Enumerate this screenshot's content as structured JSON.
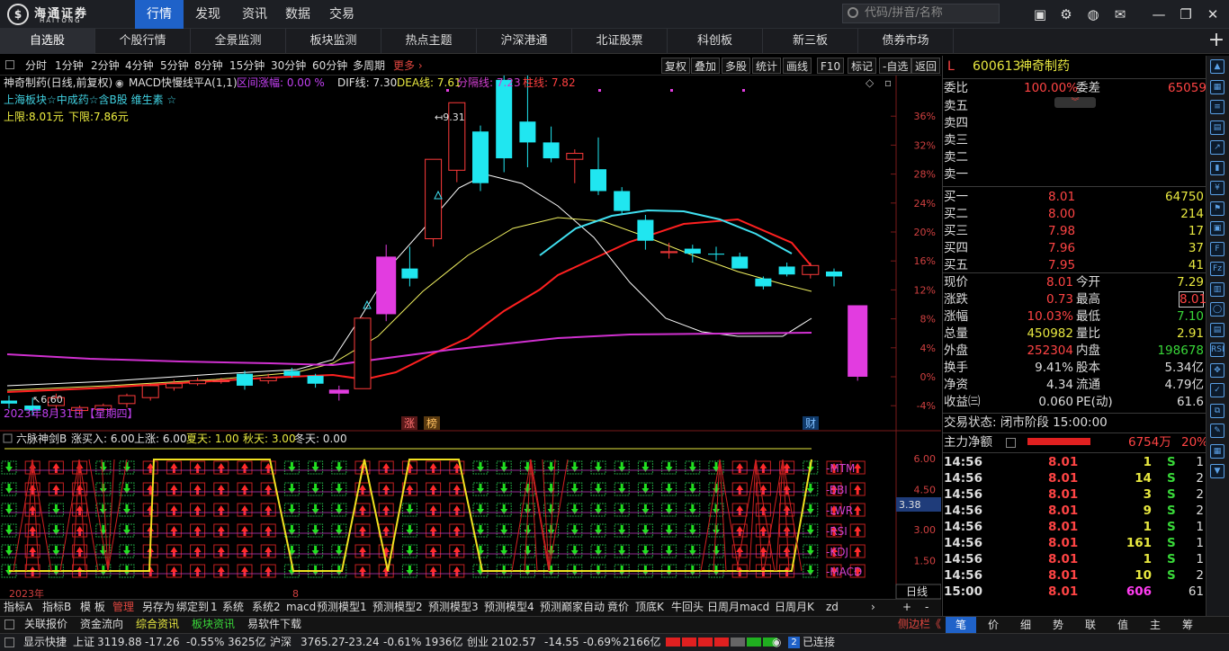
{
  "app": {
    "logo_text": "海通证券",
    "logo_sub": "HAITONG",
    "menu": [
      "行情",
      "发现",
      "资讯",
      "数据",
      "交易"
    ],
    "search_placeholder": "代码/拼音/名称"
  },
  "tabs": [
    "自选股",
    "个股行情",
    "全景监测",
    "板块监测",
    "热点主题",
    "沪深港通",
    "北证股票",
    "科创板",
    "新三板",
    "债券市场"
  ],
  "periods": [
    "分时",
    "1分钟",
    "2分钟",
    "4分钟",
    "5分钟",
    "8分钟",
    "15分钟",
    "30分钟",
    "60分钟",
    "多周期"
  ],
  "more": "更多",
  "tools": [
    "复权",
    "叠加",
    "多股",
    "统计",
    "画线",
    "F10",
    "标记",
    "-自选",
    "返回"
  ],
  "kline": {
    "title": "神奇制药(日线,前复权)",
    "indicator_name": "MACD快慢线平A(1,1)",
    "range_label": "区间涨幅: 0.00 %",
    "dif": "DIF线: 7.30",
    "dea": "DEA线: 7.61",
    "sep": "分隔线: 7.23",
    "zhu": "柱线: 7.82",
    "board": "上海板块☆中成药☆含B股 维生素 ☆",
    "upper": "上限:8.01元",
    "lower": "下限:7.86元",
    "high_label": "9.31",
    "low_label": "6.60",
    "date": "2023年8月31日【星期四】",
    "mark1": "涨",
    "mark2": "榜",
    "mark3": "财",
    "yticks": [
      "36%",
      "32%",
      "28%",
      "24%",
      "20%",
      "16%",
      "12%",
      "8%",
      "4%",
      "0%",
      "-4%"
    ]
  },
  "sub": {
    "title": "六脉神剑B",
    "buy": "涨买入: 6.00",
    "up": "上涨: 6.00",
    "summer": "夏天: 1.00",
    "autumn": "秋天: 3.00",
    "winter": "冬天: 0.00",
    "rows": [
      "MTM",
      "BBI",
      "LWR",
      "RSI",
      "KDJ",
      "MACD"
    ],
    "yticks": [
      "6.00",
      "4.50",
      "3.00",
      "1.50"
    ],
    "cursor_val": "3.38",
    "xlab1": "2023年",
    "xlab2": "8",
    "xlab3": "日线"
  },
  "chart_data": {
    "type": "candlestick",
    "candles": [
      [
        7.05,
        7.02,
        7.1,
        6.97
      ],
      [
        7.0,
        6.95,
        7.08,
        6.9
      ],
      [
        7.0,
        7.08,
        7.12,
        6.95
      ],
      [
        6.95,
        6.98,
        7.0,
        6.9
      ],
      [
        6.96,
        7.0,
        7.02,
        6.93
      ],
      [
        7.02,
        7.1,
        7.12,
        6.98
      ],
      [
        7.08,
        7.2,
        7.22,
        7.05
      ],
      [
        7.18,
        7.22,
        7.26,
        7.15
      ],
      [
        7.22,
        7.25,
        7.28,
        7.2
      ],
      [
        7.25,
        7.25,
        7.28,
        7.22
      ],
      [
        7.32,
        7.2,
        7.35,
        7.16
      ],
      [
        7.25,
        7.28,
        7.32,
        7.22
      ],
      [
        7.35,
        7.3,
        7.38,
        7.28
      ],
      [
        7.3,
        7.22,
        7.32,
        7.18
      ],
      [
        7.12,
        7.16,
        7.2,
        7.05
      ],
      [
        7.17,
        7.88,
        7.89,
        7.17
      ],
      [
        7.92,
        8.5,
        8.62,
        7.85
      ],
      [
        8.38,
        8.28,
        8.6,
        8.2
      ],
      [
        8.68,
        9.48,
        9.48,
        8.6
      ],
      [
        9.37,
        10.05,
        10.05,
        9.25
      ],
      [
        9.76,
        9.24,
        9.82,
        9.16
      ],
      [
        10.28,
        9.49,
        10.38,
        9.35
      ],
      [
        9.86,
        9.65,
        10.48,
        9.4
      ],
      [
        9.65,
        9.49,
        9.81,
        9.45
      ],
      [
        9.48,
        9.54,
        9.58,
        9.24
      ],
      [
        9.38,
        9.16,
        9.7,
        9.12
      ],
      [
        9.16,
        8.96,
        9.2,
        8.92
      ],
      [
        8.87,
        8.66,
        8.92,
        8.57
      ],
      [
        8.54,
        8.55,
        8.64,
        8.48
      ],
      [
        8.58,
        8.53,
        8.62,
        8.44
      ],
      [
        8.53,
        8.52,
        8.6,
        8.46
      ],
      [
        8.5,
        8.38,
        8.54,
        8.38
      ],
      [
        8.28,
        8.2,
        8.3,
        8.17
      ],
      [
        8.4,
        8.32,
        8.44,
        8.3
      ],
      [
        8.32,
        8.41,
        8.44,
        8.28
      ],
      [
        8.35,
        8.3,
        8.38,
        8.2
      ],
      [
        7.29,
        8.01,
        8.01,
        7.25
      ]
    ]
  },
  "right": {
    "code": "600613",
    "name": "神奇制药",
    "wb_label": "委比",
    "wb": "100.00%",
    "wc_label": "委差",
    "wc": "65059",
    "asks": [
      "卖五",
      "卖四",
      "卖三",
      "卖二",
      "卖一"
    ],
    "bids": [
      {
        "l": "买一",
        "p": "8.01",
        "v": "64750"
      },
      {
        "l": "买二",
        "p": "8.00",
        "v": "214"
      },
      {
        "l": "买三",
        "p": "7.98",
        "v": "17"
      },
      {
        "l": "买四",
        "p": "7.96",
        "v": "37"
      },
      {
        "l": "买五",
        "p": "7.95",
        "v": "41"
      }
    ],
    "stats": [
      {
        "l1": "现价",
        "v1": "8.01",
        "l2": "今开",
        "v2": "7.29"
      },
      {
        "l1": "涨跌",
        "v1": "0.73",
        "l2": "最高",
        "v2": "8.01"
      },
      {
        "l1": "涨幅",
        "v1": "10.03%",
        "l2": "最低",
        "v2": "7.10"
      },
      {
        "l1": "总量",
        "v1": "450982",
        "l2": "量比",
        "v2": "2.91"
      },
      {
        "l1": "外盘",
        "v1": "252304",
        "l2": "内盘",
        "v2": "198678"
      },
      {
        "l1": "换手",
        "v1": "9.41%",
        "l2": "股本",
        "v2": "5.34亿"
      },
      {
        "l1": "净资",
        "v1": "4.34",
        "l2": "流通",
        "v2": "4.79亿"
      },
      {
        "l1": "收益㈢",
        "v1": "0.060",
        "l2": "PE(动)",
        "v2": "61.6"
      }
    ],
    "trade_state": "交易状态: 闭市阶段 15:00:00",
    "flow_label": "主力净额",
    "flow_val": "6754万",
    "flow_pct": "20%",
    "ticks": [
      {
        "t": "14:56",
        "p": "8.01",
        "v": "1",
        "s": "S",
        "n": "1"
      },
      {
        "t": "14:56",
        "p": "8.01",
        "v": "14",
        "s": "S",
        "n": "2"
      },
      {
        "t": "14:56",
        "p": "8.01",
        "v": "3",
        "s": "S",
        "n": "2"
      },
      {
        "t": "14:56",
        "p": "8.01",
        "v": "9",
        "s": "S",
        "n": "2"
      },
      {
        "t": "14:56",
        "p": "8.01",
        "v": "1",
        "s": "S",
        "n": "1"
      },
      {
        "t": "14:56",
        "p": "8.01",
        "v": "161",
        "s": "S",
        "n": "1"
      },
      {
        "t": "14:56",
        "p": "8.01",
        "v": "1",
        "s": "S",
        "n": "1"
      },
      {
        "t": "14:56",
        "p": "8.01",
        "v": "10",
        "s": "S",
        "n": "2"
      },
      {
        "t": "15:00",
        "p": "8.01",
        "v": "606",
        "s": "",
        "n": "61"
      }
    ]
  },
  "bottom_tabs": [
    "指标A",
    "指标B",
    "模 板",
    "管理",
    "另存为",
    "绑定到",
    "1",
    "系统",
    "系统2",
    "macd",
    "预测模型1",
    "预测模型2",
    "预测模型3",
    "预测模型4",
    "预测巅家自动",
    "竟价",
    "顶底K",
    "牛回头",
    "日周月macd",
    "日周月K",
    "zd"
  ],
  "quick": [
    {
      "t": "关联报价",
      "c": "#ddd"
    },
    {
      "t": "资金流向",
      "c": "#ddd"
    },
    {
      "t": "综合资讯",
      "c": "#e8e840"
    },
    {
      "t": "板块资讯",
      "c": "#39d839"
    },
    {
      "t": "易软件下载",
      "c": "#ddd"
    }
  ],
  "side_label": "侧边栏《",
  "right_tabs": [
    "笔",
    "价",
    "细",
    "势",
    "联",
    "值",
    "主",
    "筹"
  ],
  "status": {
    "show": "显示快捷",
    "sh_label": "上证",
    "sh": "3119.88",
    "sh_chg": "-17.26",
    "sh_pct": "-0.55%",
    "sh_amt": "3625亿",
    "sz_label": "沪深",
    "sz": "3765.27",
    "sz_chg": "-23.24",
    "sz_pct": "-0.61%",
    "sz_amt": "1936亿",
    "cy_label": "创业",
    "cy": "2102.57",
    "cy_chg": "-14.55",
    "cy_pct": "-0.69%",
    "cy_amt": "2166亿",
    "conn": "2",
    "conn_label": "已连接"
  },
  "colors": {
    "accent": "#1f62c9",
    "up": "#ff4444",
    "down": "#2adfe6",
    "magenta": "#e23ce0"
  }
}
